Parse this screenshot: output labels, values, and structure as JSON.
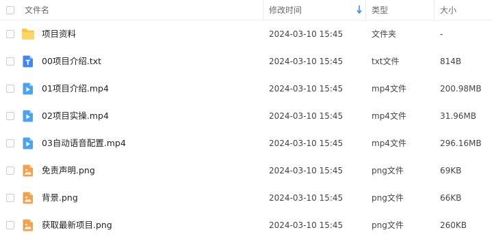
{
  "header": {
    "name": "文件名",
    "modified": "修改时间",
    "type": "类型",
    "size": "大小"
  },
  "files": [
    {
      "name": "项目资料",
      "modified": "2024-03-10 15:45",
      "type": "文件夹",
      "size": "-",
      "icon": "folder-icon"
    },
    {
      "name": "00项目介绍.txt",
      "modified": "2024-03-10 15:45",
      "type": "txt文件",
      "size": "814B",
      "icon": "text-file-icon"
    },
    {
      "name": "01项目介绍.mp4",
      "modified": "2024-03-10 15:45",
      "type": "mp4文件",
      "size": "200.98MB",
      "icon": "video-file-icon"
    },
    {
      "name": "02项目实操.mp4",
      "modified": "2024-03-10 15:45",
      "type": "mp4文件",
      "size": "31.96MB",
      "icon": "video-file-icon"
    },
    {
      "name": "03自动语音配置.mp4",
      "modified": "2024-03-10 15:45",
      "type": "mp4文件",
      "size": "296.16MB",
      "icon": "video-file-icon"
    },
    {
      "name": "免责声明.png",
      "modified": "2024-03-10 15:45",
      "type": "png文件",
      "size": "69KB",
      "icon": "image-file-icon"
    },
    {
      "name": "背景.png",
      "modified": "2024-03-10 15:45",
      "type": "png文件",
      "size": "66KB",
      "icon": "image-file-icon"
    },
    {
      "name": "获取最新项目.png",
      "modified": "2024-03-10 15:45",
      "type": "png文件",
      "size": "260KB",
      "icon": "image-file-icon"
    }
  ],
  "colors": {
    "folder": "#ffc53d",
    "text_file": "#3e86f5",
    "video_file": "#4aa3f0",
    "image_file": "#f5a04a",
    "sort_arrow": "#3d8bfd"
  }
}
